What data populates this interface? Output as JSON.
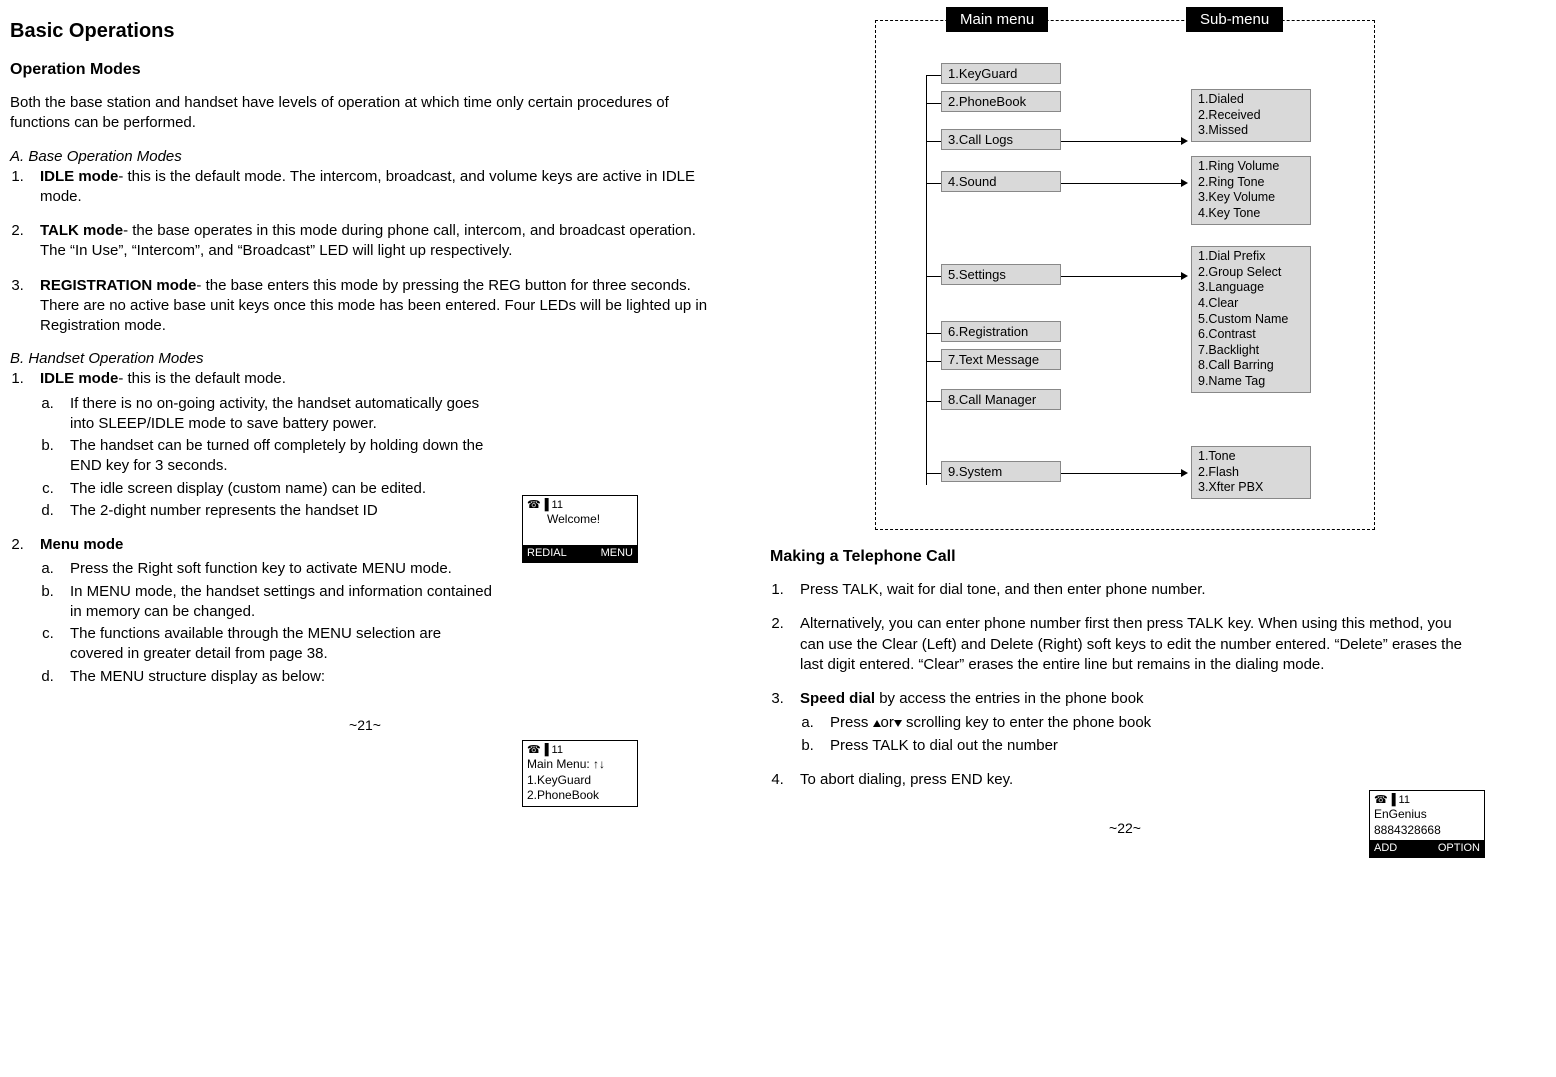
{
  "page_left": {
    "title": "Basic Operations",
    "section1_heading": "Operation Modes",
    "intro": "Both the base station and handset have levels of operation at which time only certain procedures of functions can be performed.",
    "baseModes_heading": "A. Base Operation Modes",
    "baseModes": {
      "m1_label": "IDLE mode",
      "m1_text": "- this is the default mode. The intercom, broadcast,  and volume keys are active in IDLE mode.",
      "m2_label": "TALK mode",
      "m2_text": "- the base operates in this mode during phone call, intercom, and broadcast operation. The “In Use”, “Intercom”, and “Broadcast” LED will light up respectively.",
      "m3_label": "REGISTRATION mode",
      "m3_text": "- the base enters this mode by pressing the REG button for three seconds. There are no active base unit keys once this mode has been entered.  Four LEDs will be lighted up in Registration mode."
    },
    "handsetModes_heading": "B. Handset Operation Modes",
    "handset_idle_label": "IDLE mode",
    "handset_idle_text": "- this is the default mode.",
    "handset_idle_a": "If there is no on-going activity, the handset automatically goes into SLEEP/IDLE mode to save battery power.",
    "handset_idle_b": "The handset can be turned off completely by holding down the END key for 3 seconds.",
    "handset_idle_c": "The idle screen display (custom name) can be edited.",
    "handset_idle_d": "The 2-dight number represents the handset ID",
    "handset_menu_label": "Menu mode",
    "handset_menu_a": "Press the Right soft function key to activate MENU mode.",
    "handset_menu_b": "In MENU mode, the handset settings and information contained in memory can be changed.",
    "handset_menu_c": "The functions available through the MENU selection are covered in greater detail from page 38.",
    "handset_menu_d": "The MENU structure display as below:",
    "lcd_idle": {
      "icons": "☎▐ 11",
      "line2": "      Welcome!",
      "left": "REDIAL",
      "right": "MENU"
    },
    "lcd_menu": {
      "icons": "☎▐ 11",
      "line2": "Main Menu:    ↑↓",
      "line3": "1.KeyGuard",
      "line4": "2.PhoneBook"
    },
    "pagenum": "~21~"
  },
  "diagram": {
    "tab_main": "Main menu",
    "tab_sub": "Sub-menu",
    "main_items": [
      "1.KeyGuard",
      "2.PhoneBook",
      "3.Call Logs",
      "4.Sound",
      "5.Settings",
      "6.Registration",
      "7.Text Message",
      "8.Call Manager",
      "9.System"
    ],
    "sub_calllogs": "1.Dialed\n2.Received\n3.Missed",
    "sub_sound": "1.Ring Volume\n2.Ring Tone\n3.Key Volume\n4.Key Tone",
    "sub_settings": "1.Dial Prefix\n2.Group Select\n3.Language\n4.Clear\n5.Custom Name\n6.Contrast\n7.Backlight\n8.Call Barring\n9.Name Tag",
    "sub_system": "1.Tone\n2.Flash\n3.Xfter PBX"
  },
  "page_right": {
    "section_heading": "Making a Telephone Call",
    "step1": "Press TALK, wait for dial tone, and then enter phone number.",
    "step2": "Alternatively, you can enter phone number first then press TALK key. When using this method, you can use the Clear (Left) and Delete (Right) soft keys to edit the number entered. “Delete” erases the last digit entered. “Clear” erases the entire line but remains in the dialing mode.",
    "step3_label": "Speed dial",
    "step3_text": " by access the entries in the phone book",
    "step3_a_pre": "Press ",
    "step3_a_mid": "or",
    "step3_a_post": " scrolling key to enter the phone book",
    "step3_b": "Press TALK to dial out the number",
    "step4": "To abort dialing, press END key.",
    "lcd_dial": {
      "icons": "☎▐ 11",
      "line2": "EnGenius",
      "line3": "8884328668",
      "left": "ADD",
      "right": "OPTION"
    },
    "pagenum": "~22~"
  }
}
